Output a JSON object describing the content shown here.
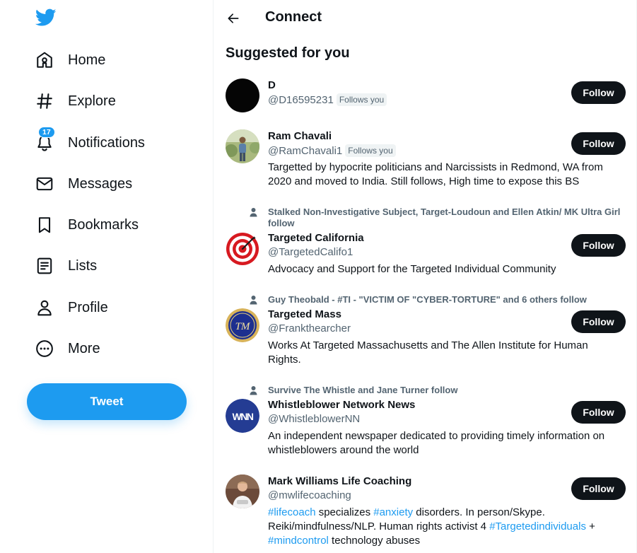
{
  "nav": {
    "items": [
      {
        "label": "Home",
        "icon": "home-icon"
      },
      {
        "label": "Explore",
        "icon": "hashtag-icon"
      },
      {
        "label": "Notifications",
        "icon": "bell-icon",
        "badge": "17"
      },
      {
        "label": "Messages",
        "icon": "envelope-icon"
      },
      {
        "label": "Bookmarks",
        "icon": "bookmark-icon"
      },
      {
        "label": "Lists",
        "icon": "list-icon"
      },
      {
        "label": "Profile",
        "icon": "person-icon"
      },
      {
        "label": "More",
        "icon": "more-circle-icon"
      }
    ],
    "tweet_label": "Tweet"
  },
  "header": {
    "title": "Connect"
  },
  "section_title": "Suggested for you",
  "colors": {
    "brand": "#1d9bf0",
    "text": "#0f1419",
    "muted": "#536471",
    "follow_button": "#0f1419"
  },
  "suggestions": [
    {
      "name": "D",
      "handle": "@D16595231",
      "follows_you": "Follows you",
      "follow_label": "Follow",
      "avatar": "black-circle-avatar"
    },
    {
      "name": "Ram Chavali",
      "handle": "@RamChavali1",
      "follows_you": "Follows you",
      "bio": "Targetted by hypocrite politicians and Narcissists in Redmond, WA from 2020 and moved to India. Still follows, High time to expose this BS",
      "follow_label": "Follow",
      "avatar": "outdoor-photo-avatar"
    },
    {
      "social_context": "Stalked Non-Investigative Subject, Target-Loudoun and Ellen Atkin/ MK Ultra Girl follow",
      "name": "Targeted California",
      "handle": "@TargetedCalifo1",
      "bio": "Advocacy and Support for the Targeted Individual Community",
      "follow_label": "Follow",
      "avatar": "target-logo-avatar"
    },
    {
      "social_context": "Guy Theobald - #TI - \"VICTIM OF \"CYBER-TORTURE\" and 6 others follow",
      "name": "Targeted Mass",
      "handle": "@Frankthearcher",
      "bio": "Works At Targeted Massachusetts and The Allen Institute for Human Rights.",
      "follow_label": "Follow",
      "avatar": "tm-seal-avatar",
      "avatar_text": "TM"
    },
    {
      "social_context": "Survive The Whistle and Jane Turner follow",
      "name": "Whistleblower Network News",
      "handle": "@WhistleblowerNN",
      "bio": "An independent newspaper dedicated to providing timely information on whistleblowers around the world",
      "follow_label": "Follow",
      "avatar": "wnn-logo-avatar",
      "avatar_text": "WNN"
    },
    {
      "name": "Mark Williams Life Coaching",
      "handle": "@mwlifecoaching",
      "bio_parts": {
        "tag1": "#lifecoach",
        "t1": " specializes ",
        "tag2": "#anxiety",
        "t2": " disorders. In person/Skype. Reiki/mindfulness/NLP. Human rights activist 4 ",
        "tag3": "#Targetedindividuals",
        "t3": " + ",
        "tag4": "#mindcontrol",
        "t4": " technology abuses"
      },
      "follow_label": "Follow",
      "avatar": "person-photo-avatar"
    }
  ]
}
